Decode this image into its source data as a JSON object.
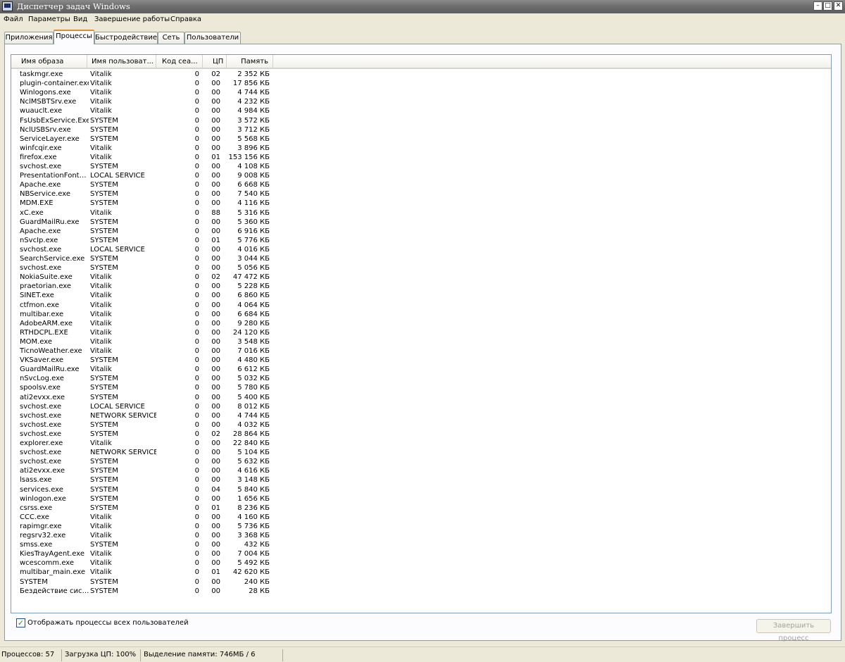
{
  "window": {
    "title": "Диспетчер задач Windows",
    "min_glyph": "–",
    "max_glyph": "□",
    "close_glyph": "✕"
  },
  "menu": [
    "Файл",
    "Параметры",
    "Вид",
    "Завершение работы",
    "Справка"
  ],
  "tabs": [
    "Приложения",
    "Процессы",
    "Быстродействие",
    "Сеть",
    "Пользователи"
  ],
  "active_tab": "Процессы",
  "columns": [
    "Имя образа",
    "Имя пользоват...",
    "Код сеа...",
    "ЦП",
    "Память"
  ],
  "processes": [
    [
      "taskmgr.exe",
      "Vitalik",
      "0",
      "02",
      "2 352 КБ"
    ],
    [
      "plugin-container.exe",
      "Vitalik",
      "0",
      "00",
      "17 856 КБ"
    ],
    [
      "Winlogons.exe",
      "Vitalik",
      "0",
      "00",
      "4 744 КБ"
    ],
    [
      "NclMSBTSrv.exe",
      "Vitalik",
      "0",
      "00",
      "4 232 КБ"
    ],
    [
      "wuauclt.exe",
      "Vitalik",
      "0",
      "00",
      "4 984 КБ"
    ],
    [
      "FsUsbExService.Exe",
      "SYSTEM",
      "0",
      "00",
      "3 572 КБ"
    ],
    [
      "NclUSBSrv.exe",
      "SYSTEM",
      "0",
      "00",
      "3 712 КБ"
    ],
    [
      "ServiceLayer.exe",
      "SYSTEM",
      "0",
      "00",
      "5 568 КБ"
    ],
    [
      "winfcqir.exe",
      "Vitalik",
      "0",
      "00",
      "3 896 КБ"
    ],
    [
      "firefox.exe",
      "Vitalik",
      "0",
      "01",
      "153 156 КБ"
    ],
    [
      "svchost.exe",
      "SYSTEM",
      "0",
      "00",
      "4 108 КБ"
    ],
    [
      "PresentationFont…",
      "LOCAL SERVICE",
      "0",
      "00",
      "9 008 КБ"
    ],
    [
      "Apache.exe",
      "SYSTEM",
      "0",
      "00",
      "6 668 КБ"
    ],
    [
      "NBService.exe",
      "SYSTEM",
      "0",
      "00",
      "7 540 КБ"
    ],
    [
      "MDM.EXE",
      "SYSTEM",
      "0",
      "00",
      "4 116 КБ"
    ],
    [
      "xC.exe",
      "Vitalik",
      "0",
      "88",
      "5 316 КБ"
    ],
    [
      "GuardMailRu.exe",
      "SYSTEM",
      "0",
      "00",
      "5 360 КБ"
    ],
    [
      "Apache.exe",
      "SYSTEM",
      "0",
      "00",
      "6 916 КБ"
    ],
    [
      "nSvcIp.exe",
      "SYSTEM",
      "0",
      "01",
      "5 776 КБ"
    ],
    [
      "svchost.exe",
      "LOCAL SERVICE",
      "0",
      "00",
      "4 016 КБ"
    ],
    [
      "SearchService.exe",
      "SYSTEM",
      "0",
      "00",
      "3 044 КБ"
    ],
    [
      "svchost.exe",
      "SYSTEM",
      "0",
      "00",
      "5 056 КБ"
    ],
    [
      "NokiaSuite.exe",
      "Vitalik",
      "0",
      "02",
      "47 472 КБ"
    ],
    [
      "praetorian.exe",
      "Vitalik",
      "0",
      "00",
      "5 228 КБ"
    ],
    [
      "SINET.exe",
      "Vitalik",
      "0",
      "00",
      "6 860 КБ"
    ],
    [
      "ctfmon.exe",
      "Vitalik",
      "0",
      "00",
      "4 064 КБ"
    ],
    [
      "multibar.exe",
      "Vitalik",
      "0",
      "00",
      "6 684 КБ"
    ],
    [
      "AdobeARM.exe",
      "Vitalik",
      "0",
      "00",
      "9 280 КБ"
    ],
    [
      "RTHDCPL.EXE",
      "Vitalik",
      "0",
      "00",
      "24 120 КБ"
    ],
    [
      "MOM.exe",
      "Vitalik",
      "0",
      "00",
      "3 548 КБ"
    ],
    [
      "TicnoWeather.exe",
      "Vitalik",
      "0",
      "00",
      "7 016 КБ"
    ],
    [
      "VKSaver.exe",
      "SYSTEM",
      "0",
      "00",
      "4 480 КБ"
    ],
    [
      "GuardMailRu.exe",
      "Vitalik",
      "0",
      "00",
      "6 612 КБ"
    ],
    [
      "nSvcLog.exe",
      "SYSTEM",
      "0",
      "00",
      "5 032 КБ"
    ],
    [
      "spoolsv.exe",
      "SYSTEM",
      "0",
      "00",
      "5 780 КБ"
    ],
    [
      "ati2evxx.exe",
      "SYSTEM",
      "0",
      "00",
      "5 400 КБ"
    ],
    [
      "svchost.exe",
      "LOCAL SERVICE",
      "0",
      "00",
      "8 012 КБ"
    ],
    [
      "svchost.exe",
      "NETWORK SERVICE",
      "0",
      "00",
      "4 744 КБ"
    ],
    [
      "svchost.exe",
      "SYSTEM",
      "0",
      "00",
      "4 032 КБ"
    ],
    [
      "svchost.exe",
      "SYSTEM",
      "0",
      "02",
      "28 864 КБ"
    ],
    [
      "explorer.exe",
      "Vitalik",
      "0",
      "00",
      "22 840 КБ"
    ],
    [
      "svchost.exe",
      "NETWORK SERVICE",
      "0",
      "00",
      "5 104 КБ"
    ],
    [
      "svchost.exe",
      "SYSTEM",
      "0",
      "00",
      "5 632 КБ"
    ],
    [
      "ati2evxx.exe",
      "SYSTEM",
      "0",
      "00",
      "4 616 КБ"
    ],
    [
      "lsass.exe",
      "SYSTEM",
      "0",
      "00",
      "3 148 КБ"
    ],
    [
      "services.exe",
      "SYSTEM",
      "0",
      "04",
      "5 840 КБ"
    ],
    [
      "winlogon.exe",
      "SYSTEM",
      "0",
      "00",
      "1 656 КБ"
    ],
    [
      "csrss.exe",
      "SYSTEM",
      "0",
      "01",
      "8 236 КБ"
    ],
    [
      "CCC.exe",
      "Vitalik",
      "0",
      "00",
      "4 160 КБ"
    ],
    [
      "rapimgr.exe",
      "Vitalik",
      "0",
      "00",
      "5 736 КБ"
    ],
    [
      "regsrv32.exe",
      "Vitalik",
      "0",
      "00",
      "3 368 КБ"
    ],
    [
      "smss.exe",
      "SYSTEM",
      "0",
      "00",
      "432 КБ"
    ],
    [
      "KiesTrayAgent.exe",
      "Vitalik",
      "0",
      "00",
      "7 004 КБ"
    ],
    [
      "wcescomm.exe",
      "Vitalik",
      "0",
      "00",
      "5 492 КБ"
    ],
    [
      "multibar_main.exe",
      "Vitalik",
      "0",
      "01",
      "42 620 КБ"
    ],
    [
      "SYSTEM",
      "SYSTEM",
      "0",
      "00",
      "240 КБ"
    ],
    [
      "Бездействие сис…",
      "SYSTEM",
      "0",
      "00",
      "28 КБ"
    ]
  ],
  "show_all_users": {
    "checked": true,
    "label": "Отображать процессы всех пользователей",
    "check_glyph": "✓"
  },
  "end_process_button": "Завершить процесс",
  "status": {
    "processes": "Процессов: 57",
    "cpu": "Загрузка ЦП: 100%",
    "memory": "Выделение памяти: 746МБ / 6"
  }
}
